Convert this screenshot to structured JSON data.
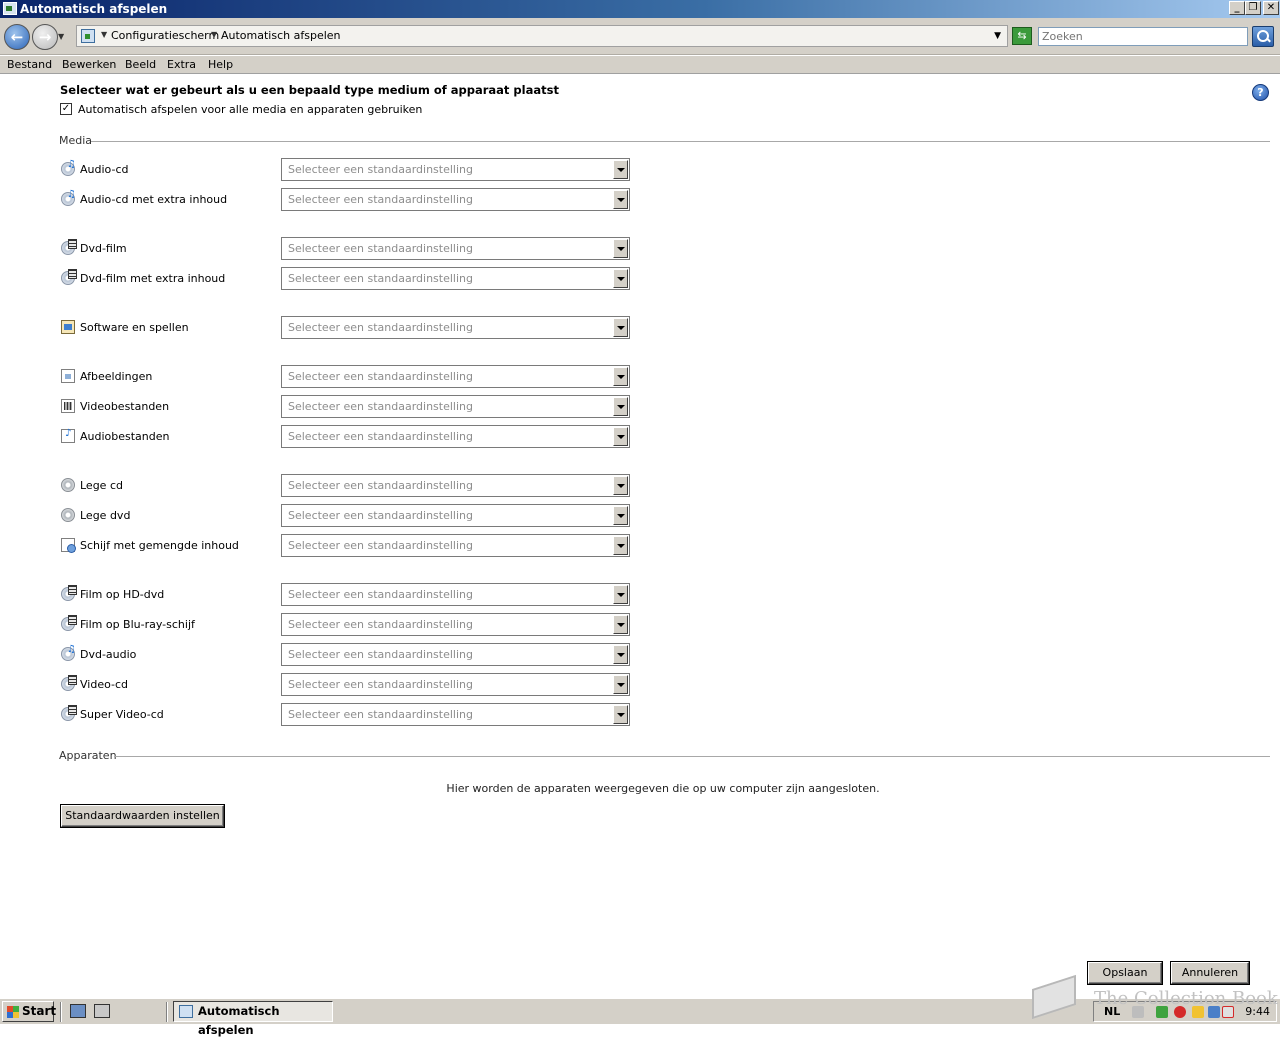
{
  "window": {
    "title": "Automatisch afspelen",
    "buttons": {
      "minimize": "_",
      "restore": "❐",
      "close": "✕"
    }
  },
  "address": {
    "crumbs": [
      "Configuratiescherm",
      "Automatisch afspelen"
    ],
    "search_placeholder": "Zoeken"
  },
  "menu": [
    "Bestand",
    "Bewerken",
    "Beeld",
    "Extra",
    "Help"
  ],
  "page": {
    "heading": "Selecteer wat er gebeurt als u een bepaald type medium of apparaat plaatst",
    "autoplay_checkbox_label": "Automatisch afspelen voor alle media en apparaten gebruiken",
    "autoplay_checked": true,
    "help_icon": "?"
  },
  "media": {
    "group_label": "Media",
    "select_placeholder": "Selecteer een standaardinstelling",
    "rows": [
      {
        "label": "Audio-cd",
        "icon": "audio-cd-icon"
      },
      {
        "label": "Audio-cd met extra inhoud",
        "icon": "audio-cd-extra-icon"
      },
      {
        "label": "Dvd-film",
        "icon": "dvd-film-icon"
      },
      {
        "label": "Dvd-film met extra inhoud",
        "icon": "dvd-film-extra-icon"
      },
      {
        "label": "Software en spellen",
        "icon": "software-icon"
      },
      {
        "label": "Afbeeldingen",
        "icon": "image-file-icon"
      },
      {
        "label": "Videobestanden",
        "icon": "video-file-icon"
      },
      {
        "label": "Audiobestanden",
        "icon": "audio-file-icon"
      },
      {
        "label": "Lege cd",
        "icon": "blank-cd-icon"
      },
      {
        "label": "Lege dvd",
        "icon": "blank-dvd-icon"
      },
      {
        "label": "Schijf met gemengde inhoud",
        "icon": "mixed-content-icon"
      },
      {
        "label": "Film op HD-dvd",
        "icon": "hd-dvd-icon"
      },
      {
        "label": "Film op Blu-ray-schijf",
        "icon": "blu-ray-icon"
      },
      {
        "label": "Dvd-audio",
        "icon": "dvd-audio-icon"
      },
      {
        "label": "Video-cd",
        "icon": "video-cd-icon"
      },
      {
        "label": "Super Video-cd",
        "icon": "super-video-cd-icon"
      }
    ]
  },
  "devices": {
    "group_label": "Apparaten",
    "message": "Hier worden de apparaten weergegeven die op uw computer zijn aangesloten.",
    "defaults_button": "Standaardwaarden instellen"
  },
  "footer": {
    "save": "Opslaan",
    "cancel": "Annuleren"
  },
  "taskbar": {
    "start": "Start",
    "task": "Automatisch afspelen",
    "language": "NL",
    "clock": "9:44"
  },
  "watermark": "The Collection Book"
}
